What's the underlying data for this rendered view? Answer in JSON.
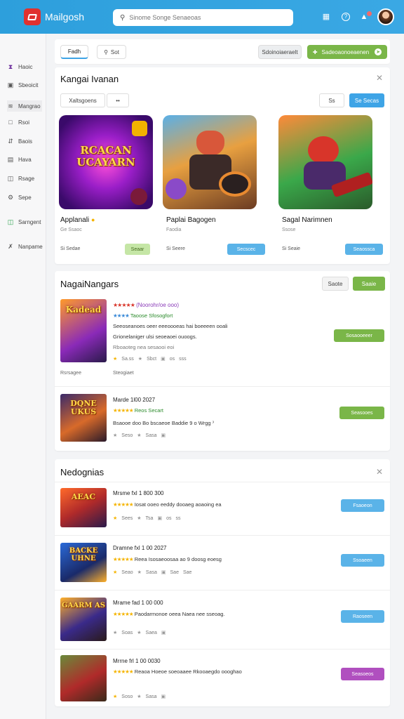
{
  "header": {
    "app_name": "Mailgosh",
    "search_placeholder": "Sinome Songe Senaeoas",
    "icons": [
      "grid-icon",
      "help-icon",
      "bell-icon"
    ]
  },
  "sidebar": {
    "items": [
      {
        "label": "Haoic",
        "icon": "home-icon"
      },
      {
        "label": "Sbeoicit",
        "icon": "box-icon"
      },
      {
        "label": "Mangrao",
        "icon": "tag-icon"
      },
      {
        "label": "Rsoi",
        "icon": "lock-icon"
      },
      {
        "label": "Baois",
        "icon": "share-icon"
      },
      {
        "label": "Hava",
        "icon": "list-icon"
      },
      {
        "label": "Rsage",
        "icon": "doc-icon"
      },
      {
        "label": "Sepe",
        "icon": "gear-icon"
      },
      {
        "label": "Sarngent",
        "icon": "shield-icon"
      },
      {
        "label": "Nanpame",
        "icon": "tools-icon"
      }
    ]
  },
  "toolbar": {
    "tab_label": "Fadh",
    "filter_label": "Sot",
    "sort_label": "Sdoinoiaeraelt",
    "primary_label": "Sadeoaonoeaenen"
  },
  "featured": {
    "title": "Kangai Ivanan",
    "filter_dropdown": "Xaltsgoens",
    "sort_dropdown": "••",
    "secondary_btn": "Ss",
    "primary_btn": "Se Secas",
    "tiles": [
      {
        "name": "Applanali",
        "sub": "Ge Ssaoc",
        "meta": "Si Sedae",
        "button": "Seaar",
        "art_text": "RCACAN UCAYARN"
      },
      {
        "name": "Paplai Bagogen",
        "sub": "Faodia",
        "meta": "Si Seere",
        "button": "Secscec"
      },
      {
        "name": "Sagal Narimnen",
        "sub": "Ssose",
        "meta": "Si Seaie",
        "button": "Seaossca"
      }
    ]
  },
  "new_section": {
    "title": "NagaiNangars",
    "btn_secondary": "Saote",
    "btn_primary": "Saaie",
    "rows": [
      {
        "title": "(Noorohr/oe ooo)",
        "rating": "Taoose Sfosogfort",
        "desc1": "Seeoseanoes oeer eeeoooeas hai boeeeen ooali",
        "desc2": "Grionelaniger ulsi seoeaoei ouoogs.",
        "desc3": "Rboaoteg nea sesaooi eoi",
        "meta": [
          "Sa.ss",
          "Sbct",
          "os",
          "sss"
        ],
        "button": "Sosaooeeer",
        "art_text": "Kadead",
        "tag1": "Rsrsagee",
        "tag2": "Steogiaet"
      },
      {
        "title": "Marde 1l00 2027",
        "rating": "Reos Secart",
        "desc1": "Bsaooe doo Bo bscaeoe Baddie 9 o Wrgg ˀ",
        "desc2": "",
        "desc3": "",
        "meta": [
          "Seso",
          "Sasa",
          "",
          ""
        ],
        "button": "Seasooes",
        "art_text": "DQNE UKUS"
      }
    ]
  },
  "recommend": {
    "title": "Nedognias",
    "rows": [
      {
        "title": "Mrsme fxl 1 800 300",
        "rating": "Iosat ooeo eeddy dooaeg aoaoing ea",
        "meta": [
          "Sees",
          "Tsa",
          "os",
          "ss"
        ],
        "button": "Fsaoeon",
        "art_text": "AEAC"
      },
      {
        "title": "Dramne fxl 1 00 2027",
        "rating": "Reea Isosaeoosaa ao 9 doosg eoesg",
        "meta": [
          "Seao",
          "Sasa",
          "Sae",
          "Sae"
        ],
        "button": "Ssoaeen",
        "art_text": "BACKE UHNE"
      },
      {
        "title": "Mrame fad 1 00 000",
        "rating": "Paodarmonoe oeea Naea nee sseoag.",
        "meta": [
          "Soas",
          "Saea",
          "",
          ""
        ],
        "button": "Raoseen",
        "art_text": "GAARM AS"
      },
      {
        "title": "Mrrne frl 1 00 0030",
        "rating": "Reaoa Hoeoe soeoaaee Rkooaegdo oooghao",
        "meta": [
          "Soso",
          "Sasa",
          "",
          ""
        ],
        "button": "Seasoeos",
        "art_text": ""
      }
    ]
  },
  "colors": {
    "header": "#3aa8e4",
    "accent_green": "#7ab648",
    "accent_blue": "#3ea4e6",
    "accent_purple": "#b04fbf",
    "star": "#f5b400"
  }
}
